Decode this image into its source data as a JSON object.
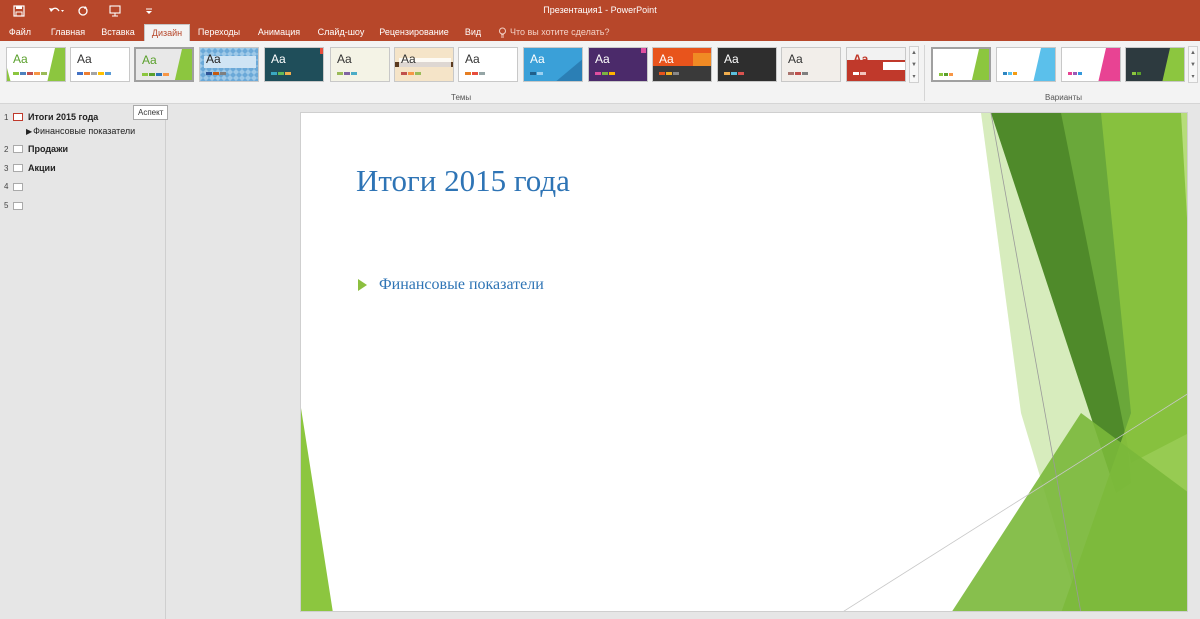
{
  "window": {
    "title": "Презентация1 - PowerPoint"
  },
  "qat": [
    {
      "name": "save-icon"
    },
    {
      "name": "undo-icon"
    },
    {
      "name": "redo-icon"
    },
    {
      "name": "present-icon"
    },
    {
      "name": "customize-icon"
    }
  ],
  "tabs": [
    {
      "label": "Файл"
    },
    {
      "label": "Главная"
    },
    {
      "label": "Вставка"
    },
    {
      "label": "Дизайн",
      "active": true
    },
    {
      "label": "Переходы"
    },
    {
      "label": "Анимация"
    },
    {
      "label": "Слайд-шоу"
    },
    {
      "label": "Рецензирование"
    },
    {
      "label": "Вид"
    }
  ],
  "tell_me": "Что вы хотите сделать?",
  "ribbon": {
    "themes_label": "Темы",
    "variants_label": "Варианты",
    "theme_glyph": "Aa"
  },
  "tooltip": "Аспект",
  "outline": {
    "slides": [
      {
        "num": "1",
        "title": "Итоги 2015 года",
        "sub": "Финансовые показатели"
      },
      {
        "num": "2",
        "title": "Продажи"
      },
      {
        "num": "3",
        "title": "Акции"
      },
      {
        "num": "4",
        "title": ""
      },
      {
        "num": "5",
        "title": ""
      }
    ]
  },
  "slide": {
    "title": "Итоги 2015 года",
    "bullet": "Финансовые показатели"
  },
  "colors": {
    "accent": "#b7472a",
    "slide_text": "#2e74b5",
    "green": "#8cbf3f"
  }
}
